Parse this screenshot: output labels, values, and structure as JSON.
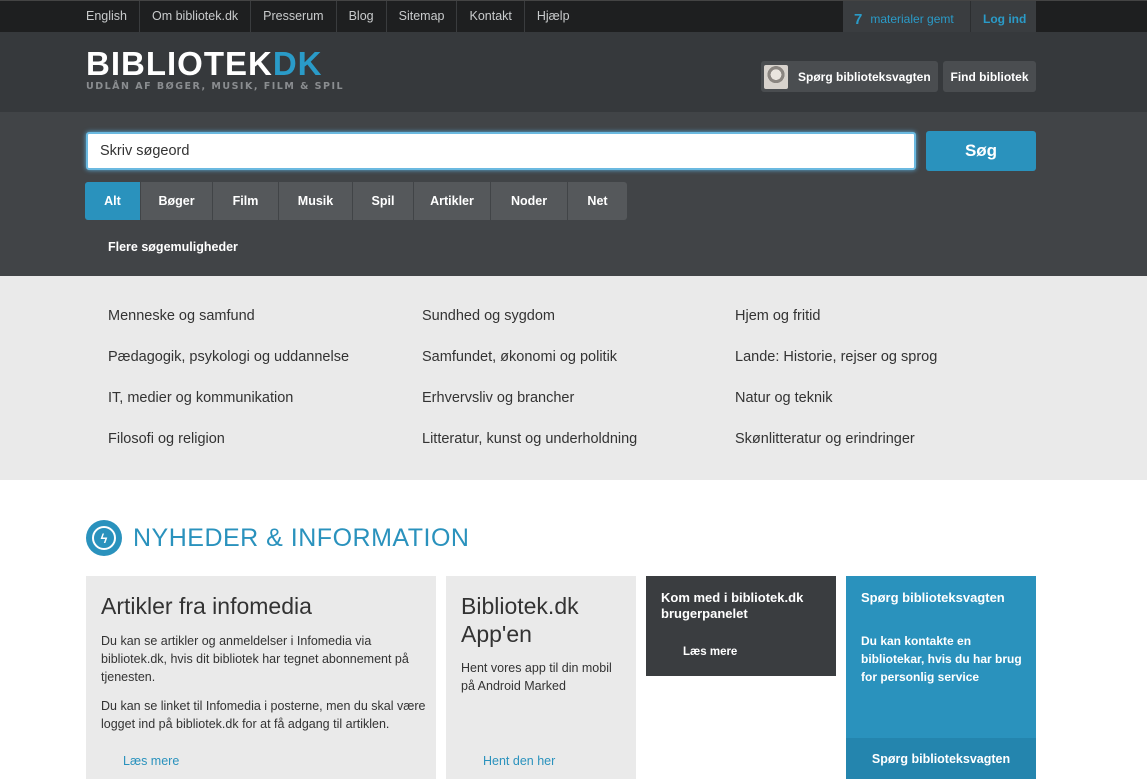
{
  "topbar": {
    "links": [
      "English",
      "Om bibliotek.dk",
      "Presserum",
      "Blog",
      "Sitemap",
      "Kontakt",
      "Hjælp"
    ],
    "saved_count": "7",
    "saved_label": "materialer gemt",
    "login_label": "Log ind"
  },
  "header": {
    "logo_main": "BIBLIOTEK",
    "logo_accent": "DK",
    "logo_tagline": "UDLÅN AF BØGER, MUSIK, FILM & SPIL",
    "ask_button": "Spørg biblioteksvagten",
    "find_button": "Find bibliotek"
  },
  "search": {
    "value": "Skriv søgeord",
    "button": "Søg",
    "filters": [
      "Alt",
      "Bøger",
      "Film",
      "Musik",
      "Spil",
      "Artikler",
      "Noder",
      "Net"
    ],
    "active_filter": "Alt",
    "more_options": "Flere søgemuligheder"
  },
  "categories": {
    "col1": [
      "Menneske og samfund",
      "Pædagogik, psykologi og uddannelse",
      "IT, medier og kommunikation",
      "Filosofi og religion"
    ],
    "col2": [
      "Sundhed og sygdom",
      "Samfundet, økonomi og politik",
      "Erhvervsliv og brancher",
      "Litteratur, kunst og underholdning"
    ],
    "col3": [
      "Hjem og fritid",
      "Lande: Historie, rejser og sprog",
      "Natur og teknik",
      "Skønlitteratur og erindringer"
    ]
  },
  "news": {
    "title": "NYHEDER & INFORMATION",
    "card1": {
      "title": "Artikler fra infomedia",
      "p1": "Du kan se artikler og anmeldelser i Infomedia via bibliotek.dk, hvis dit bibliotek har tegnet abonnement på tjenesten.",
      "p2": "Du kan se linket til Infomedia i posterne, men du skal være logget ind på bibliotek.dk for at få adgang til artiklen.",
      "link": "Læs mere"
    },
    "card2": {
      "title_line1": "Bibliotek.dk",
      "title_line2": "App'en",
      "p1": "Hent vores app til din mobil på Android Marked",
      "link": "Hent den her"
    },
    "card3": {
      "title": "Kom med i bibliotek.dk brugerpanelet",
      "link": "Læs mere"
    },
    "card4": {
      "title": "Spørg biblioteksvagten",
      "p1": "Du kan kontakte en bibliotekar, hvis du har brug for personlig service",
      "button": "Spørg biblioteksvagten"
    }
  },
  "colors": {
    "accent": "#2a92bd",
    "header_bg": "#36393c",
    "search_bg": "#414447",
    "categories_bg": "#eaeaea"
  }
}
